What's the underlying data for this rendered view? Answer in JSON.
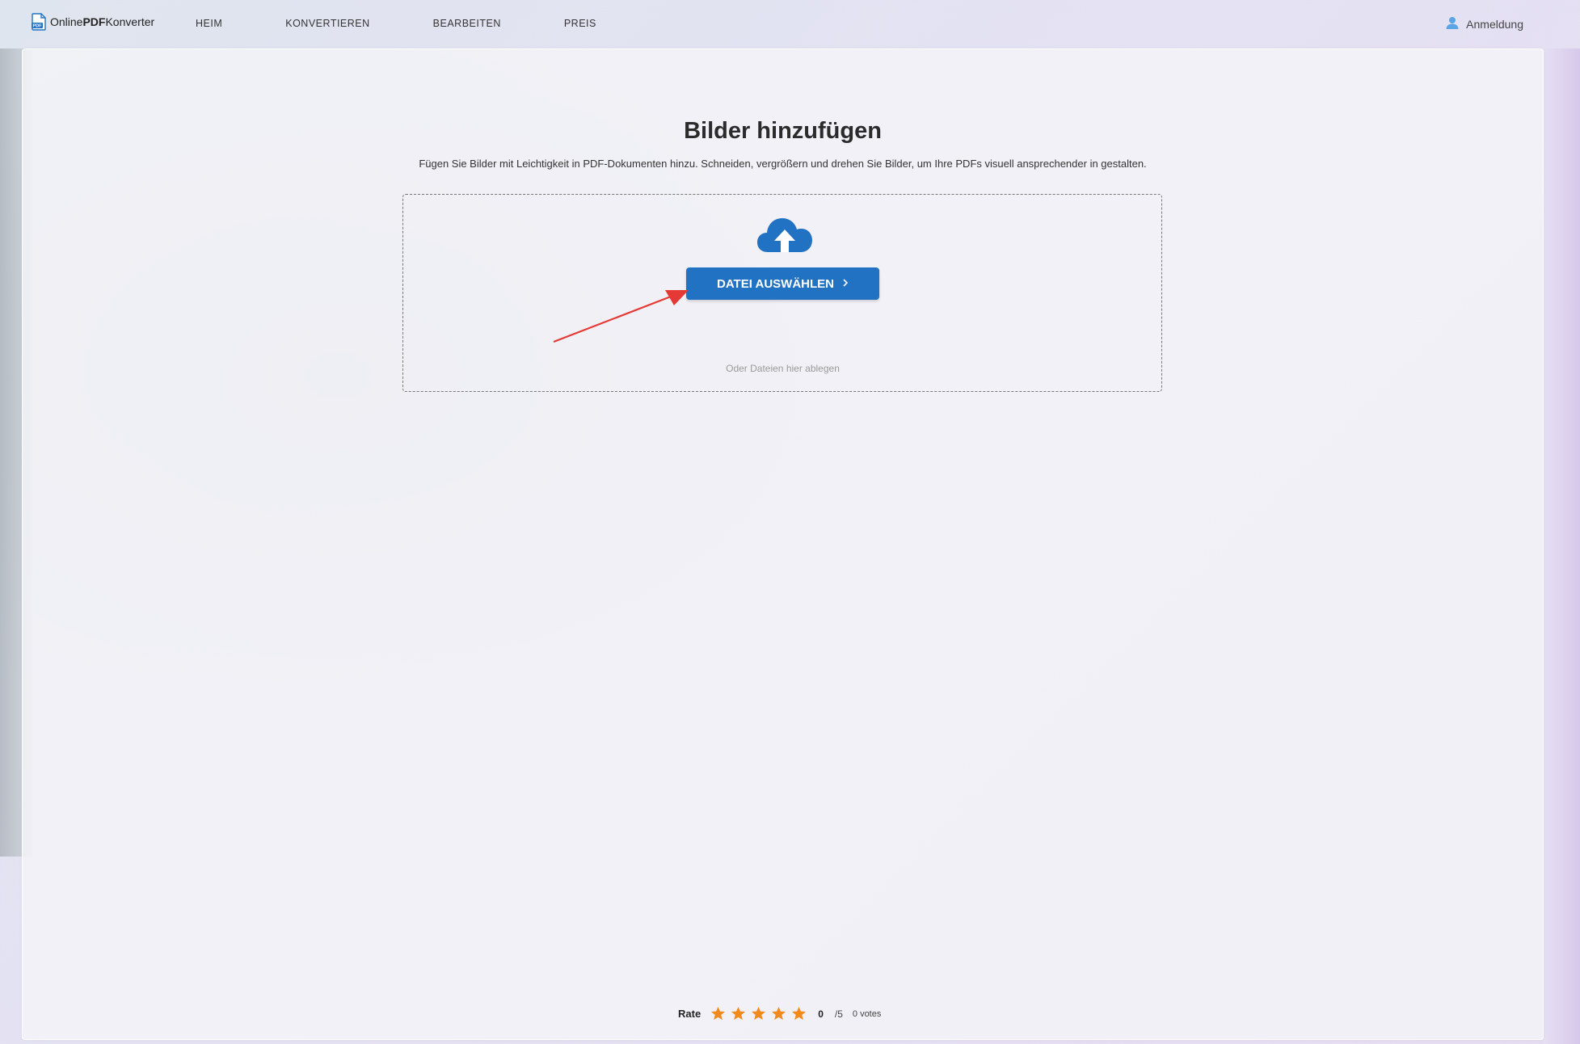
{
  "header": {
    "logo": {
      "text_light": "Online",
      "text_bold": "PDF",
      "text_rest": "Konverter",
      "icon": "pdf-file-icon"
    },
    "nav": [
      {
        "label": "HEIM"
      },
      {
        "label": "KONVERTIEREN"
      },
      {
        "label": "BEARBEITEN"
      },
      {
        "label": "PREIS"
      }
    ],
    "login": {
      "label": "Anmeldung",
      "icon": "user-icon"
    }
  },
  "main": {
    "title": "Bilder hinzufügen",
    "subtitle": "Fügen Sie Bilder mit Leichtigkeit in PDF-Dokumenten hinzu. Schneiden, vergrößern und drehen Sie Bilder, um Ihre PDFs visuell ansprechender in gestalten.",
    "upload": {
      "icon": "cloud-upload-icon",
      "button_label": "DATEI AUSWÄHLEN",
      "button_icon": "chevron-right-icon",
      "drop_hint": "Oder Dateien hier ablegen"
    }
  },
  "rating": {
    "label": "Rate",
    "stars": 5,
    "score": "0",
    "out_of": "/5",
    "votes": "0 votes"
  },
  "colors": {
    "primary": "#2272c3",
    "star": "#f08a1c",
    "annotation_arrow": "#e53935"
  }
}
